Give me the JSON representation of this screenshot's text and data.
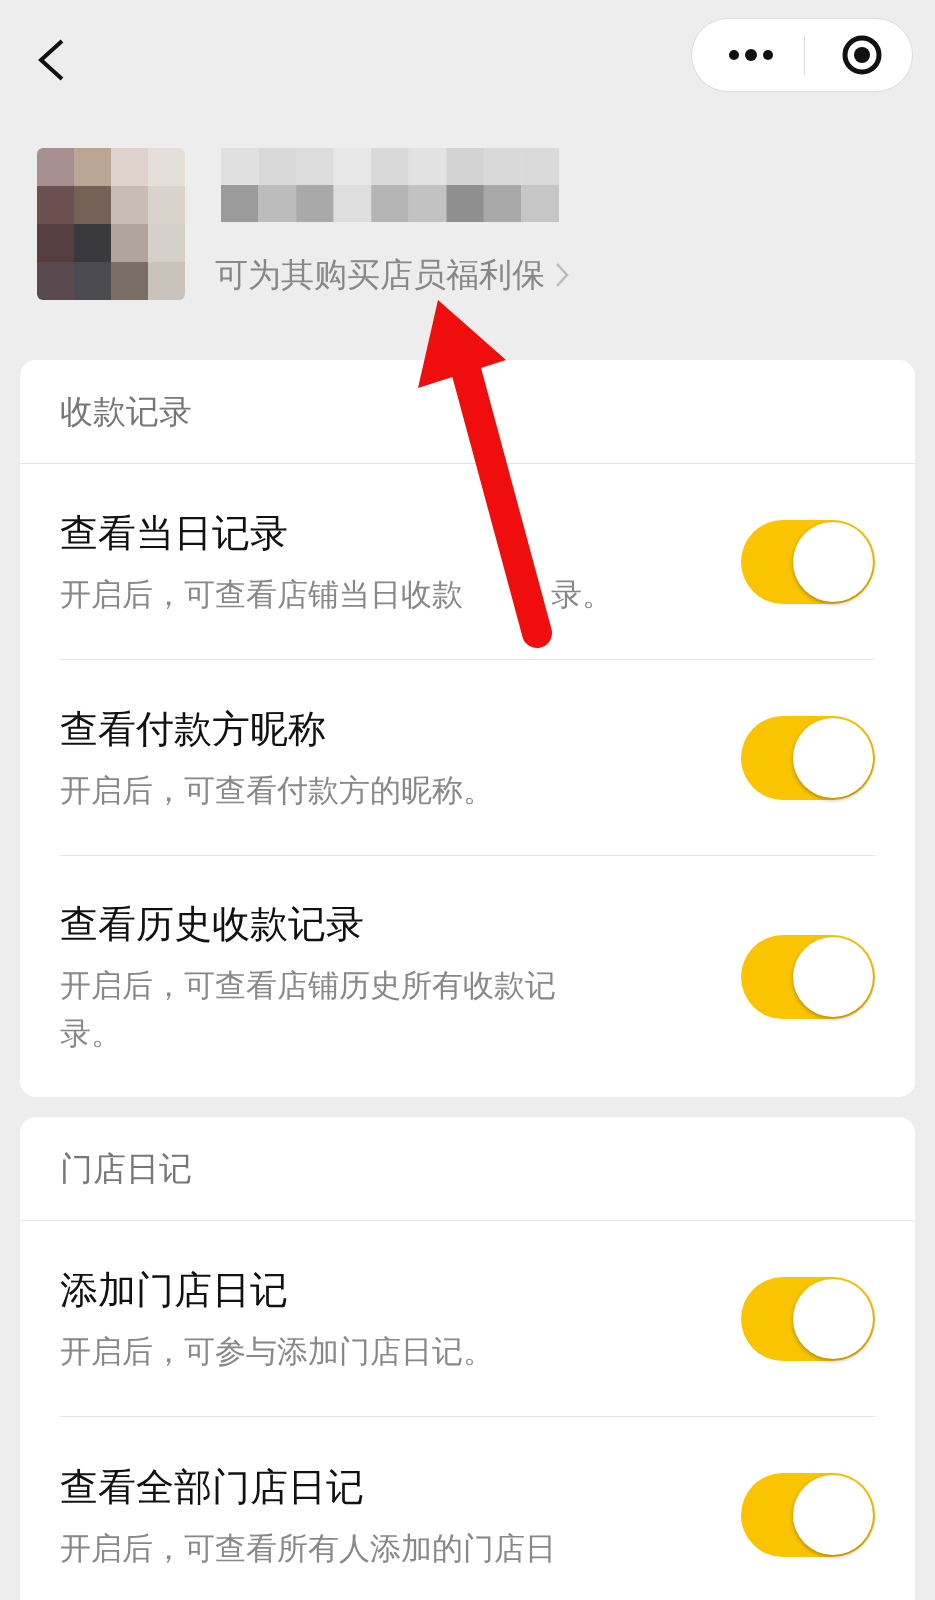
{
  "profile": {
    "subtitle": "可为其购买店员福利保"
  },
  "sections": [
    {
      "title": "收款记录",
      "rows": [
        {
          "title": "查看当日记录",
          "description": "开启后，可查看店铺当日收款",
          "description_after": "录。",
          "on": true
        },
        {
          "title": "查看付款方昵称",
          "description": "开启后，可查看付款方的昵称。",
          "on": true
        },
        {
          "title": "查看历史收款记录",
          "description": "开启后，可查看店铺历史所有收款记录。",
          "on": true
        }
      ]
    },
    {
      "title": "门店日记",
      "rows": [
        {
          "title": "添加门店日记",
          "description": "开启后，可参与添加门店日记。",
          "on": true
        },
        {
          "title": "查看全部门店日记",
          "description": "开启后，可查看所有人添加的门店日",
          "on": true
        }
      ]
    }
  ]
}
